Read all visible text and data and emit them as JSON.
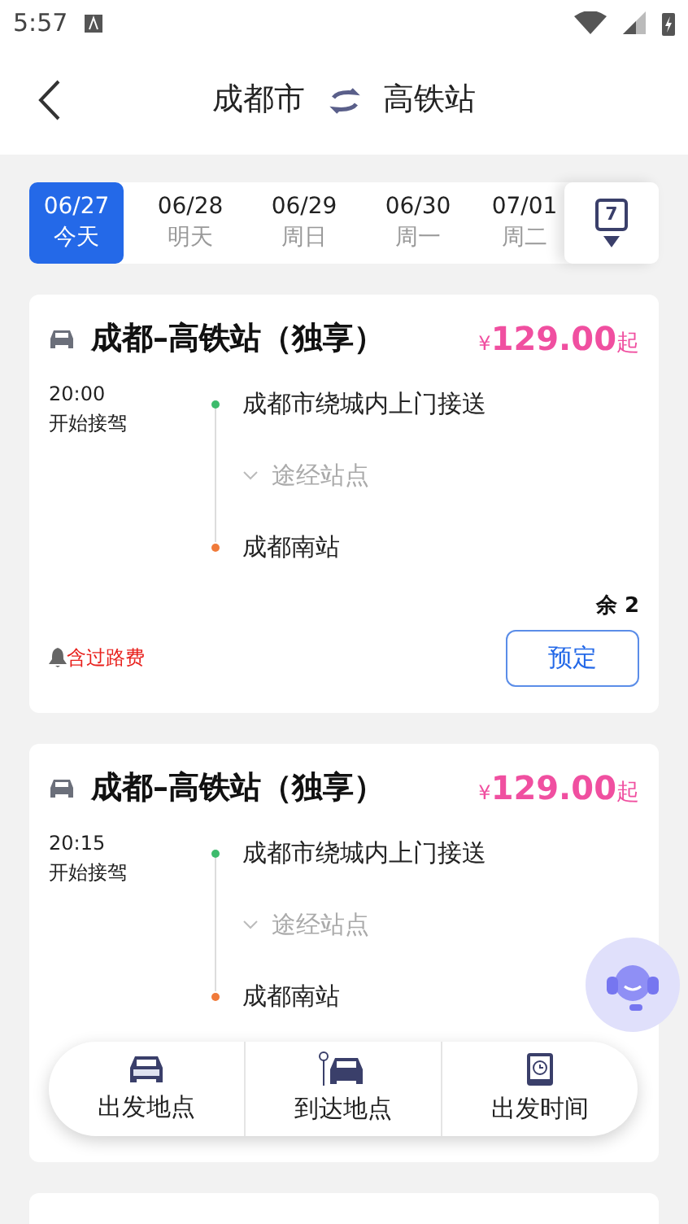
{
  "status_bar": {
    "time": "5:57"
  },
  "header": {
    "from": "成都市",
    "to": "高铁站"
  },
  "dates": [
    {
      "date": "06/27",
      "day": "今天",
      "selected": true
    },
    {
      "date": "06/28",
      "day": "明天",
      "selected": false
    },
    {
      "date": "06/29",
      "day": "周日",
      "selected": false
    },
    {
      "date": "06/30",
      "day": "周一",
      "selected": false
    },
    {
      "date": "07/01",
      "day": "周二",
      "selected": false
    }
  ],
  "calendar_button": {
    "day": "7"
  },
  "routes": [
    {
      "title": "成都–高铁站（独享）",
      "currency": "¥",
      "price": "129.00",
      "price_suffix": "起",
      "time": "20:00",
      "time_label": "开始接驾",
      "stops": [
        {
          "kind": "stop",
          "name": "成都市绕城内上门接送",
          "color": "#3dbb6c"
        },
        {
          "kind": "via",
          "name": "途经站点"
        },
        {
          "kind": "stop",
          "name": "成都南站",
          "color": "#f07a3a"
        }
      ],
      "remaining": "余 2",
      "fee_note": "含过路费",
      "button": "预定"
    },
    {
      "title": "成都–高铁站（独享）",
      "currency": "¥",
      "price": "129.00",
      "price_suffix": "起",
      "time": "20:15",
      "time_label": "开始接驾",
      "stops": [
        {
          "kind": "stop",
          "name": "成都市绕城内上门接送",
          "color": "#3dbb6c"
        },
        {
          "kind": "via",
          "name": "途经站点"
        },
        {
          "kind": "stop",
          "name": "成都南站",
          "color": "#f07a3a"
        }
      ]
    }
  ],
  "bottom_bar": [
    {
      "kind": "depart",
      "label": "出发地点"
    },
    {
      "kind": "arrive",
      "label": "到达地点"
    },
    {
      "kind": "time",
      "label": "出发时间"
    }
  ]
}
